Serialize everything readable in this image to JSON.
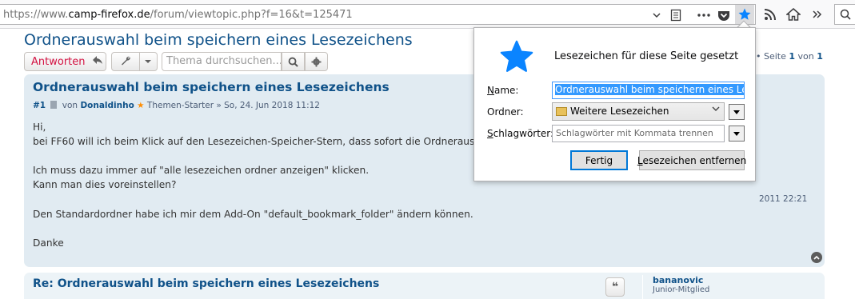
{
  "browser": {
    "url_prefix": "https://www.",
    "url_host": "camp-firefox.de",
    "url_path": "/forum/viewtopic.php?f=16&t=125471",
    "icons": [
      "chevron-down-icon",
      "reader-view-icon",
      "page-actions-icon",
      "pocket-icon",
      "bookmark-star-icon",
      "rss-icon",
      "home-icon",
      "search-icon"
    ],
    "accent": "#0a84ff"
  },
  "forum": {
    "topic_title": "Ordnerauswahl beim speichern eines Lesezeichens",
    "reply_label": "Antworten",
    "search_placeholder": "Thema durchsuchen...",
    "pagination_prefix": "• Seite",
    "pagination_page": "1",
    "pagination_of": "von",
    "pagination_total": "1"
  },
  "post1": {
    "title": "Ordnerauswahl beim speichern eines Lesezeichens",
    "number": "#1",
    "by": "von",
    "author": "Donaldinho",
    "role": "Themen-Starter",
    "date": "» So, 24. Jun 2018 11:12",
    "body": "Hi,\nbei FF60 will ich beim Klick auf den Lesezeichen-Speicher-Stern, dass sofort die Ordnerauswah\n\nIch muss dazu immer auf \"alle lesezeichen ordner anzeigen\" klicken.\nKann man dies voreinstellen?\n\nDen Standardordner habe ich mir dem Add-On \"default_bookmark_folder\" ändern können.\n\nDanke",
    "right_date": "2011 22:21"
  },
  "post2": {
    "title": "Re: Ordnerauswahl beim speichern eines Lesezeichens",
    "author": "bananovic",
    "rank": "Junior-Mitglied"
  },
  "bookmark_panel": {
    "heading": "Lesezeichen für diese Seite gesetzt",
    "name_label": "Name:",
    "name_value": "Ordnerauswahl beim speichern eines Lesezeichens",
    "folder_label": "Ordner:",
    "folder_value": "Weitere Lesezeichen",
    "tags_label": "Schlagwörter:",
    "tags_placeholder": "Schlagwörter mit Kommata trennen",
    "done_label": "Fertig",
    "remove_label": "Lesezeichen entfernen",
    "star_color": "#0a84ff"
  }
}
